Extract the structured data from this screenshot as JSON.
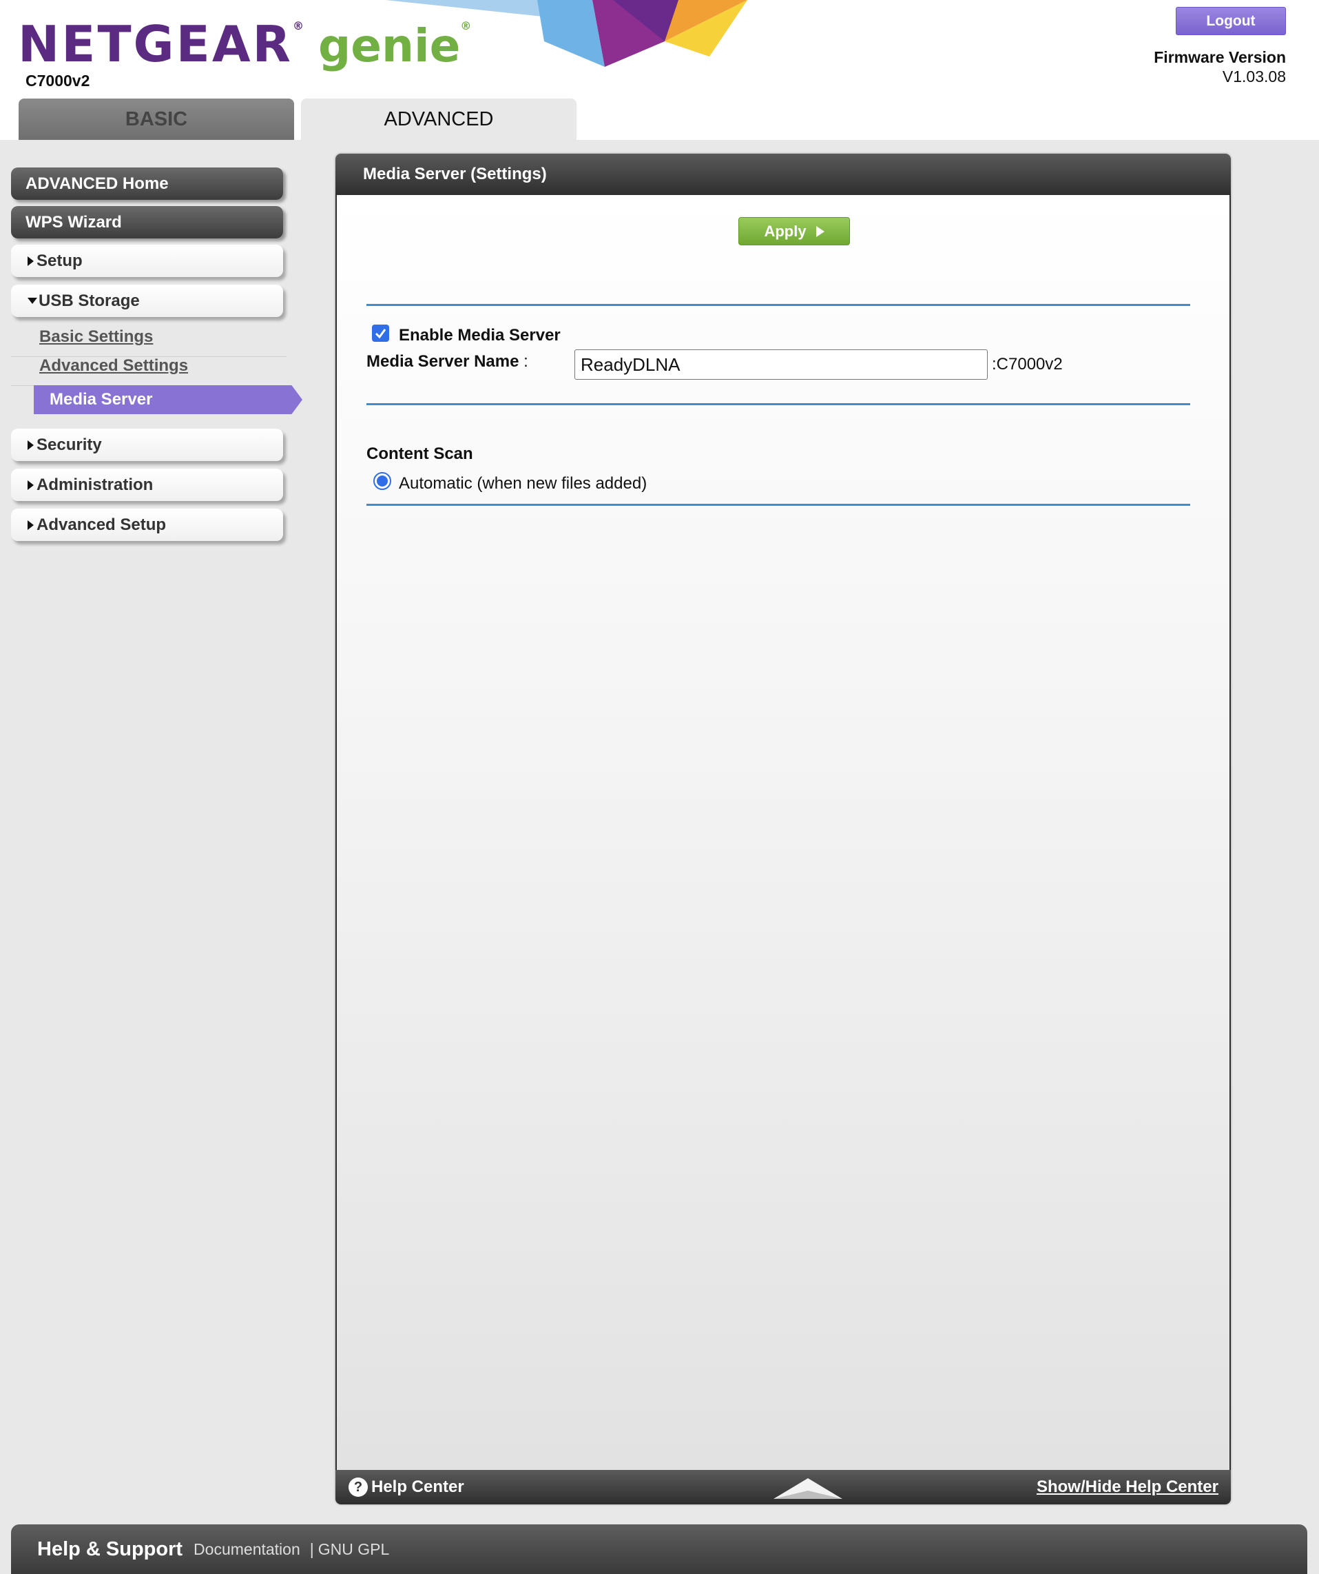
{
  "header": {
    "logo_netgear": "NETGEAR",
    "logo_genie": "genie",
    "registered_mark": "®",
    "model": "C7000v2",
    "logout_label": "Logout",
    "firmware_label": "Firmware Version",
    "firmware_value": "V1.03.08",
    "colors": {
      "brand_purple": "#5b2b82",
      "genie_green": "#72b043"
    }
  },
  "tabs": [
    {
      "label": "BASIC",
      "active": false
    },
    {
      "label": "ADVANCED",
      "active": true
    }
  ],
  "sidebar": {
    "items": [
      {
        "label": "ADVANCED Home",
        "style": "dark"
      },
      {
        "label": "WPS Wizard",
        "style": "dark"
      },
      {
        "label": "Setup",
        "style": "light",
        "icon": "triangle-right-icon"
      },
      {
        "label": "USB Storage",
        "style": "light",
        "icon": "triangle-down-icon",
        "expanded": true
      },
      {
        "label": "Security",
        "style": "light",
        "icon": "triangle-right-icon"
      },
      {
        "label": "Administration",
        "style": "light",
        "icon": "triangle-right-icon"
      },
      {
        "label": "Advanced Setup",
        "style": "light",
        "icon": "triangle-right-icon"
      }
    ],
    "usb_subitems": [
      {
        "label": "Basic Settings"
      },
      {
        "label": "Advanced Settings"
      },
      {
        "label": "Media Server",
        "active": true
      }
    ],
    "active_color": "#8873d4"
  },
  "panel": {
    "title": "Media Server (Settings)",
    "apply_label": "Apply",
    "enable_label": "Enable Media Server",
    "enable_checked": true,
    "name_label": "Media Server Name",
    "name_colon": " :",
    "name_value": "ReadyDLNA",
    "name_suffix": ":C7000v2",
    "content_scan_label": "Content Scan",
    "auto_option_label": "Automatic (when new files added)",
    "auto_selected": true,
    "help_icon_glyph": "?",
    "help_center_label": "Help Center",
    "show_hide_label": "Show/Hide Help Center",
    "colors": {
      "apply_green": "#6fa832",
      "rule_blue": "#3d8ed0",
      "control_blue": "#2f6ee6"
    }
  },
  "footer": {
    "title": "Help & Support",
    "documentation": "Documentation",
    "separator": "|",
    "gpl": "GNU GPL"
  }
}
